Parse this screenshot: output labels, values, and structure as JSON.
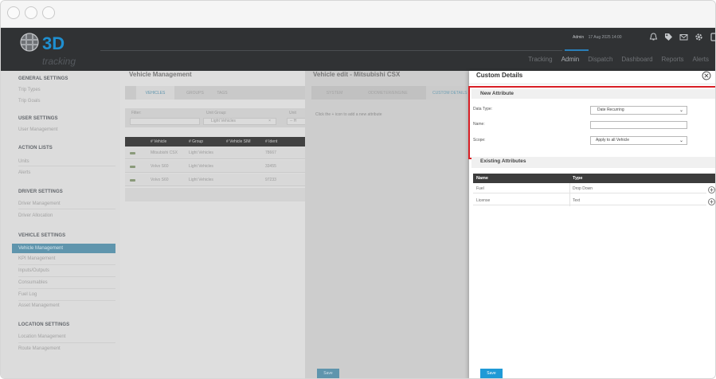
{
  "header": {
    "logo_text": "3D",
    "logo_sub": "tracking",
    "user": "Admin",
    "datetime": "17 Aug 2025 14:00",
    "nav": [
      "Tracking",
      "Admin",
      "Dispatch",
      "Dashboard",
      "Reports",
      "Alerts"
    ],
    "active_nav": "Admin",
    "icons": [
      "bell-icon",
      "tag-icon",
      "mail-icon",
      "gear-icon",
      "device-icon"
    ]
  },
  "sidebar": {
    "general_title": "GENERAL SETTINGS",
    "general_items": [
      "Trip Types",
      "Trip Goals"
    ],
    "user_title": "USER SETTINGS",
    "user_items": [
      "User Management"
    ],
    "action_title": "ACTION LISTS",
    "action_items": [
      "Units",
      "Alerts"
    ],
    "driver_title": "DRIVER SETTINGS",
    "driver_items": [
      "Driver Management",
      "Driver Allocation"
    ],
    "vehicle_title": "VEHICLE SETTINGS",
    "vehicle_items": [
      "Vehicle Management",
      "KPI Management",
      "Inputs/Outputs",
      "Consumables",
      "Fuel Log",
      "Asset Management"
    ],
    "vehicle_active": "Vehicle Management",
    "location_title": "LOCATION SETTINGS",
    "location_items": [
      "Location Management",
      "Route Management"
    ]
  },
  "vehicle_management": {
    "title": "Vehicle Management",
    "tabs": [
      "VEHICLES",
      "GROUPS",
      "TAGS"
    ],
    "active_tab": "VEHICLES",
    "filter_label": "Filter:",
    "unit_group_label": "Unit Group:",
    "unit_group_value": "Light Vehicles",
    "unit_group_clear": "×",
    "third_label": "Unit",
    "third_value": "-- H",
    "columns": [
      "# Vehicle",
      "# Group",
      "# Vehicle SIM",
      "# Ident"
    ],
    "rows": [
      {
        "vehicle": "Mitsubishi CSX",
        "group": "Light Vehicles",
        "sim": "",
        "ident": "78667"
      },
      {
        "vehicle": "Volvo S60",
        "group": "Light Vehicles",
        "sim": "",
        "ident": "33455"
      },
      {
        "vehicle": "Volvo S60",
        "group": "Light Vehicles",
        "sim": "",
        "ident": "97233"
      }
    ]
  },
  "vehicle_edit": {
    "title": "Vehicle edit - Mitsubishi CSX",
    "tabs": [
      "SYSTEM",
      "ODOMETER/ENGINE",
      "CUSTOM DETAILS"
    ],
    "active_tab": "CUSTOM DETAILS",
    "hint": "Click the + icon to add a new attribute",
    "save_label": "Save"
  },
  "custom_details": {
    "title": "Custom Details",
    "new_attribute": {
      "title": "New Attribute",
      "data_type_label": "Data Type:",
      "data_type_value": "Date Recurring",
      "name_label": "Name:",
      "name_value": "",
      "scope_label": "Scope:",
      "scope_value": "Apply to all Vehicle"
    },
    "existing": {
      "title": "Existing Attributes",
      "columns": [
        "Name",
        "Type"
      ],
      "rows": [
        {
          "name": "Fuel",
          "type": "Drop Down"
        },
        {
          "name": "License",
          "type": "Text"
        }
      ]
    },
    "save_label": "Save"
  },
  "colors": {
    "header_bg": "#303234",
    "accent": "#5f95ad",
    "highlight_border": "#d81e25",
    "save_button": "#1f9ad6"
  }
}
